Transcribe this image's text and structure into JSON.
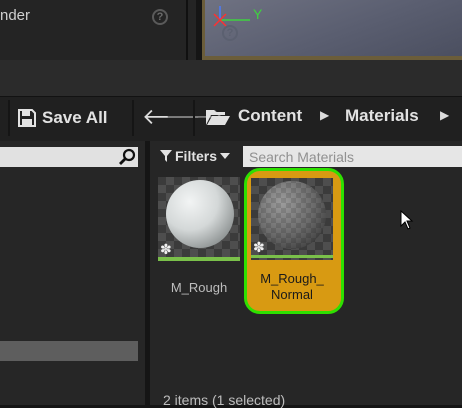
{
  "top_panel": {
    "render_label": "nder",
    "help_glyph": "?"
  },
  "viewport": {
    "axis_y": "Y"
  },
  "toolbar": {
    "save_all_label": "Save All"
  },
  "breadcrumb": {
    "items": [
      "Content",
      "Materials"
    ]
  },
  "content_browser": {
    "filters_label": "Filters",
    "search_placeholder": "Search Materials",
    "assets": [
      {
        "name": "M_Rough",
        "selected": false
      },
      {
        "name": "M_Rough_\nNormal",
        "selected": true
      }
    ],
    "status": "2 items (1 selected)"
  },
  "colors": {
    "selection_fill": "#d89a12",
    "selection_outline": "#2ee000",
    "asset_type_bar": "#7ac04a"
  },
  "icons": [
    "help-icon",
    "save-icon",
    "back-arrow-icon",
    "forward-arrow-icon",
    "folder-icon",
    "chevron-right-icon",
    "search-icon",
    "filter-icon",
    "dropdown-caret-icon",
    "star-icon",
    "mouse-cursor-icon"
  ]
}
